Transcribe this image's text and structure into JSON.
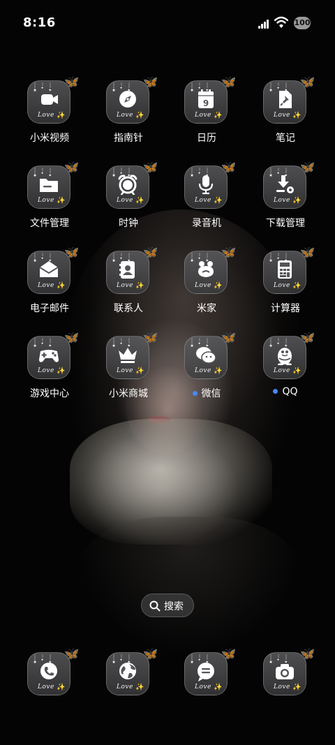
{
  "status_bar": {
    "time": "8:16",
    "battery": "100",
    "signal_icon": "signal-bars-icon",
    "wifi_icon": "wifi-icon"
  },
  "tile_decoration": {
    "text": "Love",
    "sparkle": "✨",
    "butterfly": "🦋"
  },
  "apps": [
    {
      "label": "小米视频",
      "icon": "video-camera-icon"
    },
    {
      "label": "指南针",
      "icon": "compass-icon"
    },
    {
      "label": "日历",
      "icon": "calendar-icon",
      "day": "9"
    },
    {
      "label": "笔记",
      "icon": "pin-note-icon"
    },
    {
      "label": "文件管理",
      "icon": "folder-icon"
    },
    {
      "label": "时钟",
      "icon": "alarm-clock-icon"
    },
    {
      "label": "录音机",
      "icon": "microphone-icon"
    },
    {
      "label": "下载管理",
      "icon": "download-icon"
    },
    {
      "label": "电子邮件",
      "icon": "mail-icon"
    },
    {
      "label": "联系人",
      "icon": "contacts-icon"
    },
    {
      "label": "米家",
      "icon": "smart-home-icon"
    },
    {
      "label": "计算器",
      "icon": "calculator-icon"
    },
    {
      "label": "游戏中心",
      "icon": "gamepad-icon"
    },
    {
      "label": "小米商城",
      "icon": "crown-icon"
    },
    {
      "label": "微信",
      "icon": "wechat-icon",
      "new_dot": true
    },
    {
      "label": "QQ",
      "icon": "penguin-icon",
      "new_dot": true
    }
  ],
  "search": {
    "label": "搜索",
    "icon": "search-icon"
  },
  "dock": [
    {
      "icon": "phone-icon"
    },
    {
      "icon": "globe-browser-icon"
    },
    {
      "icon": "message-bubble-icon"
    },
    {
      "icon": "camera-icon"
    }
  ],
  "colors": {
    "new_dot": "#4a86ff",
    "sparkle": "#f5d96b"
  }
}
